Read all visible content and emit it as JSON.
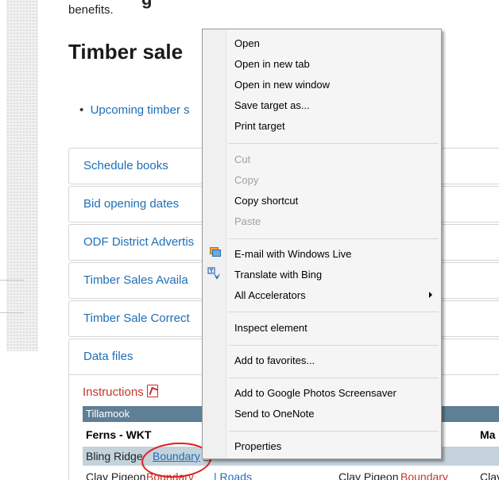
{
  "page": {
    "heading_top": "g",
    "benefits": "benefits.",
    "title": "Timber sale",
    "bullet_link": "Upcoming timber s",
    "accordions": [
      {
        "label": "Schedule books"
      },
      {
        "label": "Bid opening dates"
      },
      {
        "label": "ODF District Advertis"
      },
      {
        "label": "Timber Sales Availa"
      },
      {
        "label": "Timber Sale Correct"
      },
      {
        "label": "Data files"
      }
    ],
    "files": {
      "instructions": "Instructions",
      "region": "Tillamook",
      "row1_left": "Ferns - WKT",
      "row1_right": "Ma",
      "row2_name": "Bling Ridge",
      "row2_link": "Boundary",
      "row3_a": "Clay Pigeon",
      "row3_b": "Boundary",
      "row3_c": "| Roads",
      "row3_d": "Clay Pigeon",
      "row3_e": "Boundary",
      "row3_f": "Clay"
    }
  },
  "context_menu": {
    "items": [
      {
        "label": "Open",
        "disabled": false
      },
      {
        "label": "Open in new tab",
        "disabled": false
      },
      {
        "label": "Open in new window",
        "disabled": false
      },
      {
        "label": "Save target as...",
        "disabled": false
      },
      {
        "label": "Print target",
        "disabled": false
      },
      {
        "label": "Cut",
        "disabled": true
      },
      {
        "label": "Copy",
        "disabled": true
      },
      {
        "label": "Copy shortcut",
        "disabled": false
      },
      {
        "label": "Paste",
        "disabled": true
      },
      {
        "label": "E-mail with Windows Live",
        "disabled": false,
        "icon": "email-windows-live-icon"
      },
      {
        "label": "Translate with Bing",
        "disabled": false,
        "icon": "translate-icon"
      },
      {
        "label": "All Accelerators",
        "disabled": false,
        "submenu": true
      },
      {
        "label": "Inspect element",
        "disabled": false
      },
      {
        "label": "Add to favorites...",
        "disabled": false
      },
      {
        "label": "Add to Google Photos Screensaver",
        "disabled": false
      },
      {
        "label": "Send to OneNote",
        "disabled": false
      },
      {
        "label": "Properties",
        "disabled": false
      }
    ]
  },
  "colors": {
    "link": "#1d6fb8",
    "highlight": "#fbff20",
    "annotation_circle": "#e02020",
    "table_header": "#5f7f96"
  }
}
